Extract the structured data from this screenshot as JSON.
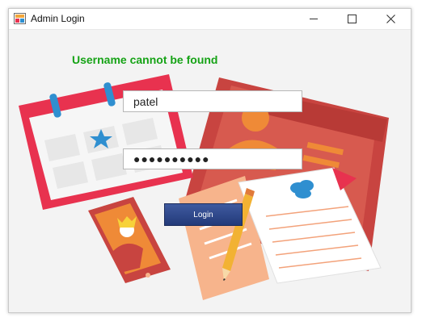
{
  "window": {
    "title": "Admin Login"
  },
  "login": {
    "error_message": "Username cannot be found",
    "username_value": "patel",
    "password_mask": "●●●●●●●●●●",
    "login_label": "Login"
  },
  "colors": {
    "error": "#16a316",
    "button": "#2e4a8c",
    "calendar": "#e8324f",
    "folder": "#c84440"
  },
  "icons": {
    "app": "app-icon",
    "minimize": "minimize-icon",
    "maximize": "maximize-icon",
    "close": "close-icon"
  }
}
